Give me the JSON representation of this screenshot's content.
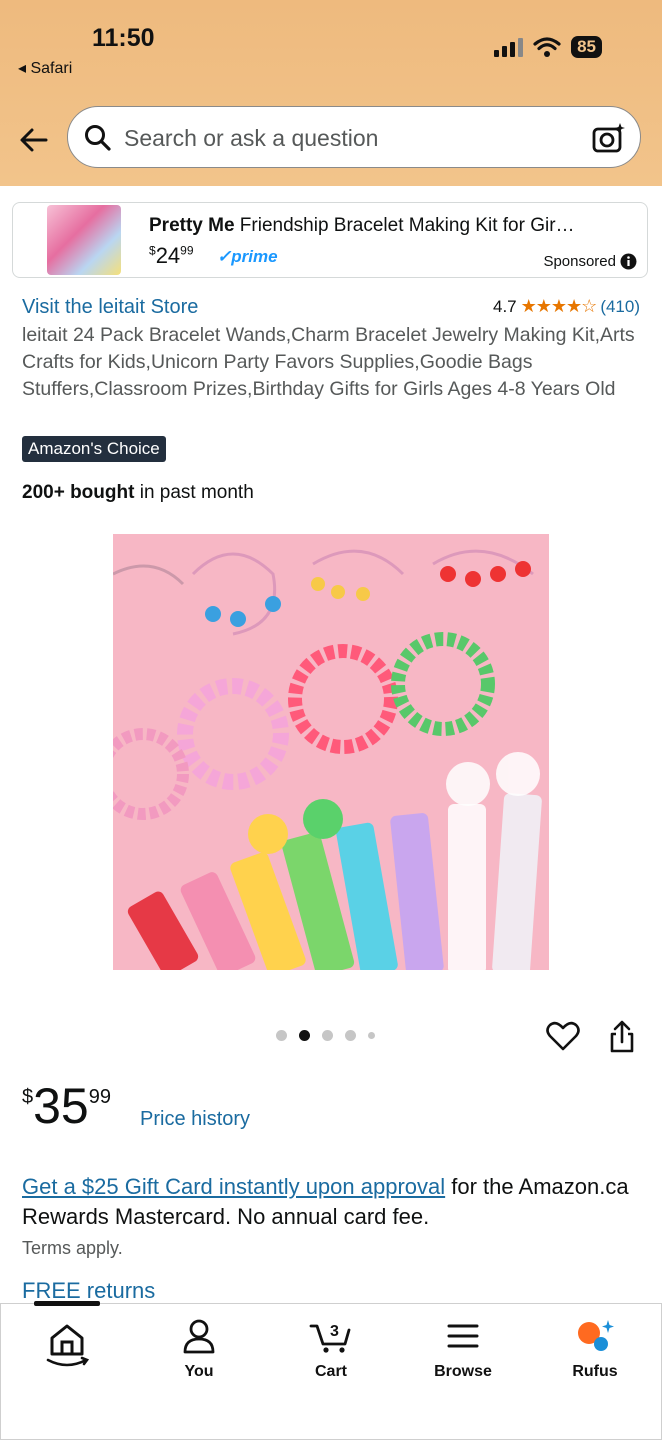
{
  "status": {
    "time": "11:50",
    "back_app": "Safari",
    "battery": "85"
  },
  "search": {
    "placeholder": "Search or ask a question"
  },
  "sponsored": {
    "brand": "Pretty Me",
    "title_rest": " Friendship Bracelet Making Kit for Gir…",
    "price_currency": "$",
    "price_whole": "24",
    "price_fraction": "99",
    "prime_label": "prime",
    "sponsored_label": "Sponsored"
  },
  "product": {
    "store_link": "Visit the leitait Store",
    "rating_value": "4.7",
    "rating_stars": "★★★★☆",
    "rating_count": "(410)",
    "description": "leitait 24 Pack Bracelet Wands,Charm Bracelet Jewelry Making Kit,Arts Crafts for Kids,Unicorn Party Favors Supplies,Goodie Bags Stuffers,Classroom Prizes,Birthday Gifts for Girls Ages 4-8 Years Old",
    "badge": "Amazon's Choice",
    "bought_bold": "200+ bought",
    "bought_rest": " in past month",
    "price_currency": "$",
    "price_whole": "35",
    "price_fraction": "99",
    "price_history": "Price history"
  },
  "offer": {
    "link": "Get a $25 Gift Card instantly upon approval",
    "rest": " for the Amazon.ca Rewards Mastercard. No annual card fee.",
    "terms": "Terms apply.",
    "free_returns": "FREE returns"
  },
  "tabs": [
    {
      "label": "",
      "icon": "home-icon"
    },
    {
      "label": "You",
      "icon": "user-icon"
    },
    {
      "label": "Cart",
      "icon": "cart-icon",
      "count": "3"
    },
    {
      "label": "Browse",
      "icon": "menu-icon"
    },
    {
      "label": "Rufus",
      "icon": "rufus-icon"
    }
  ],
  "colors": {
    "header_bg": "#f2c48b",
    "link": "#1a6ba0",
    "star": "#e77600",
    "badge_bg": "#232f3e"
  }
}
